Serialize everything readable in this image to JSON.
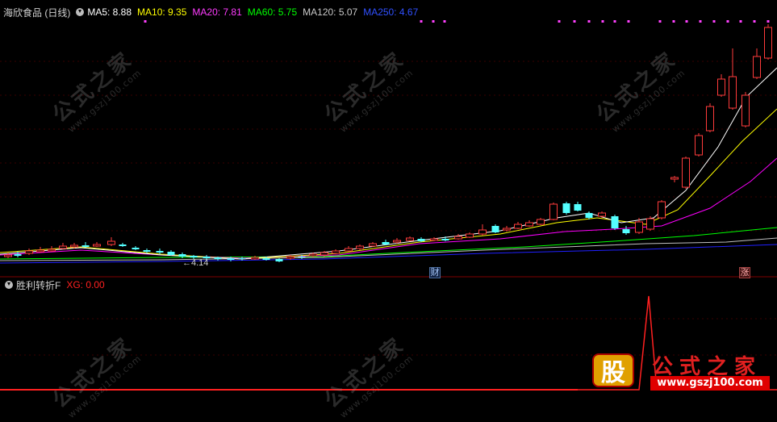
{
  "main_header": {
    "stock": "海欣食品 (日线)",
    "ma5": "MA5: 8.88",
    "ma10": "MA10: 9.35",
    "ma20": "MA20: 7.81",
    "ma60": "MA60: 5.75",
    "ma120": "MA120: 5.07",
    "ma250": "MA250: 4.67"
  },
  "sub_header": {
    "indicator": "胜利转折F",
    "xg": "XG: 0.00"
  },
  "low_label": "←4.14",
  "markers": {
    "cai": "财",
    "zhang": "涨"
  },
  "watermark": {
    "text": "公式之家",
    "url": "www.gszj100.com"
  },
  "logo": {
    "badge": "股",
    "title": "公式之家",
    "url": "www.gszj100.com"
  },
  "colors": {
    "up": "#ff3b3b",
    "down": "#54ffff",
    "ma5": "#ffffff",
    "ma10": "#ffff00",
    "ma20": "#ff00ff",
    "ma60": "#00ff00",
    "ma120": "#c0c0c0",
    "ma250": "#2020ff"
  }
}
